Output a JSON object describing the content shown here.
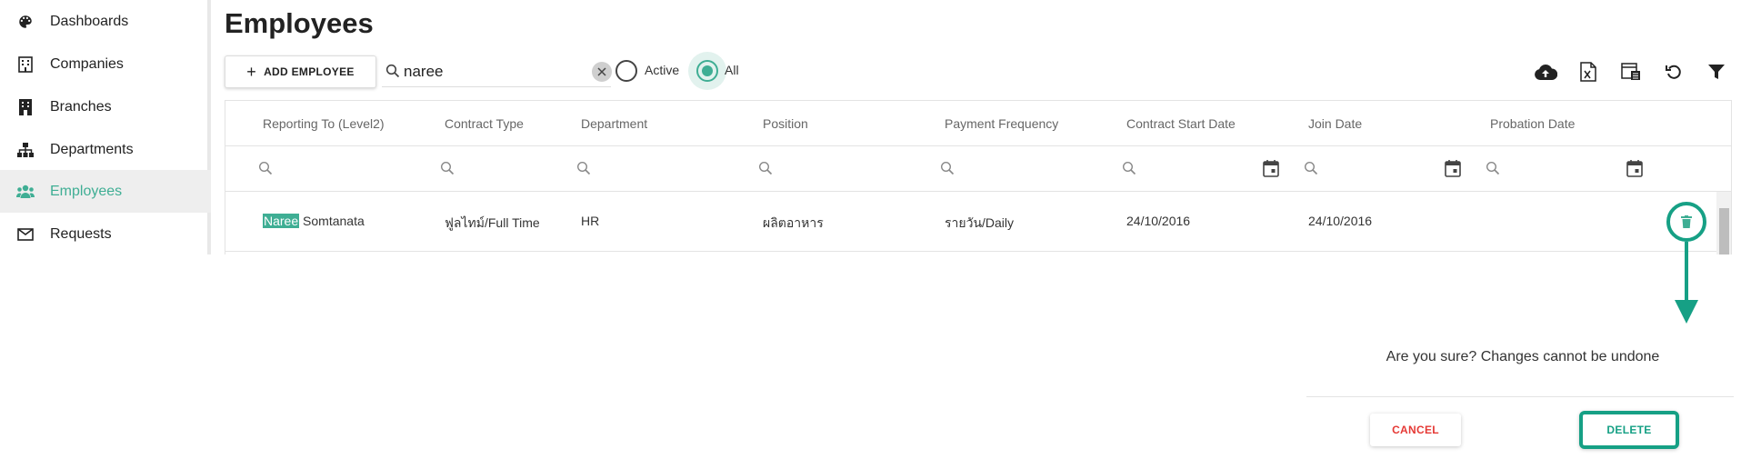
{
  "sidebar": {
    "items": [
      {
        "label": "Dashboards",
        "icon": "palette-icon"
      },
      {
        "label": "Companies",
        "icon": "building-icon"
      },
      {
        "label": "Branches",
        "icon": "office-icon"
      },
      {
        "label": "Departments",
        "icon": "org-chart-icon"
      },
      {
        "label": "Employees",
        "icon": "people-icon",
        "active": true
      },
      {
        "label": "Requests",
        "icon": "mail-icon"
      }
    ]
  },
  "page": {
    "title": "Employees"
  },
  "toolbar": {
    "add_label": "ADD EMPLOYEE",
    "search_value": "naree",
    "filter_active_label": "Active",
    "filter_all_label": "All",
    "selected_filter": "All",
    "actions": [
      "cloud-upload-icon",
      "excel-export-icon",
      "column-chooser-icon",
      "refresh-icon",
      "filter-icon"
    ]
  },
  "table": {
    "columns": [
      "Reporting To (Level2)",
      "Contract Type",
      "Department",
      "Position",
      "Payment Frequency",
      "Contract Start Date",
      "Join Date",
      "Probation Date"
    ],
    "rows": [
      {
        "reporting_to_highlight": "Naree",
        "reporting_to_rest": " Somtanata",
        "contract_type": "ฟูลไทม์/Full Time",
        "department": "HR",
        "position": "ผลิตอาหาร",
        "payment_frequency": "รายวัน/Daily",
        "contract_start_date": "24/10/2016",
        "join_date": "24/10/2016",
        "probation_date": ""
      }
    ]
  },
  "confirm": {
    "message": "Are you sure? Changes cannot be undone",
    "cancel_label": "CANCEL",
    "delete_label": "DELETE"
  },
  "colors": {
    "accent": "#3fae94",
    "callout": "#16a085",
    "danger": "#e53935"
  }
}
